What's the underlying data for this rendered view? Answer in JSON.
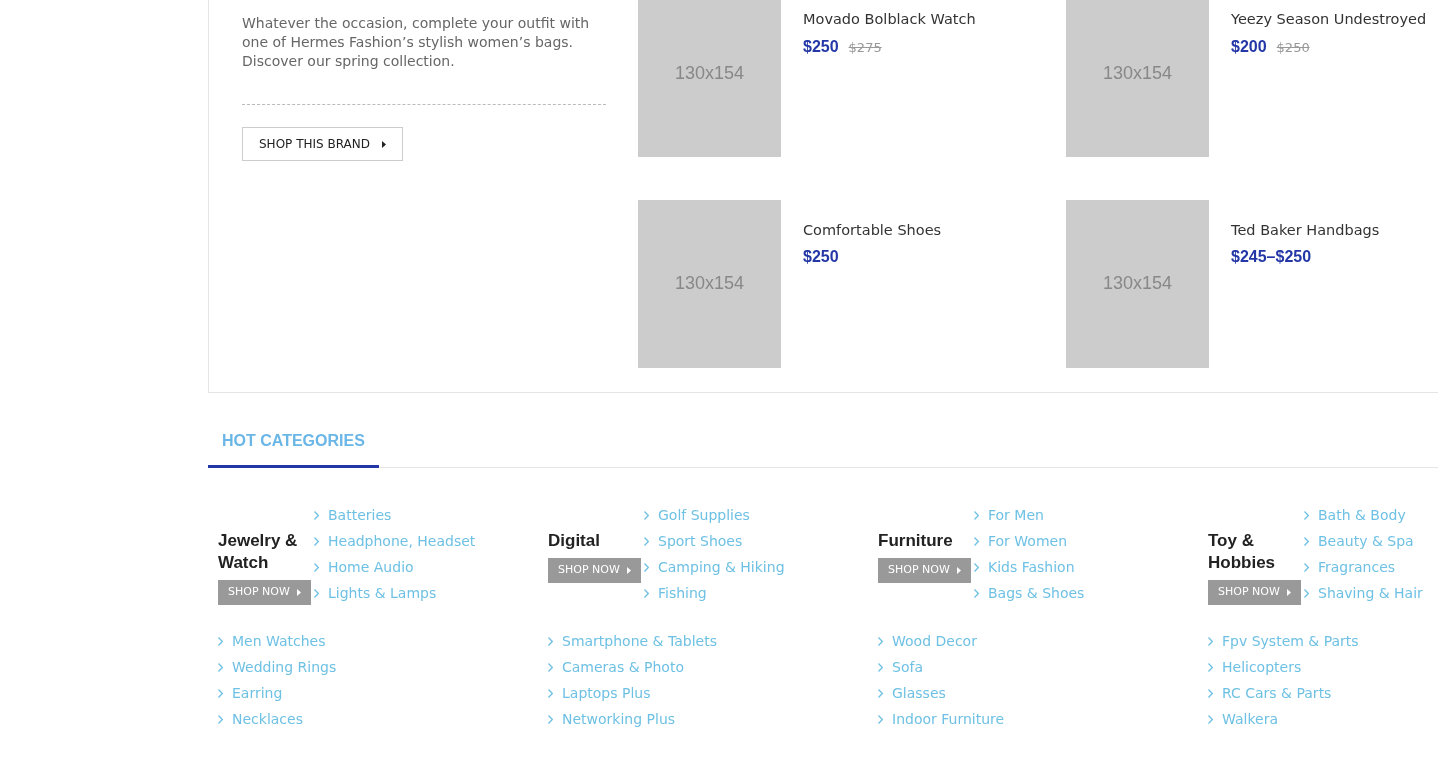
{
  "brand": {
    "description": "Whatever the occasion, complete your outfit with one of Hermes Fashion’s stylish women’s bags. Discover our spring collection.",
    "button": "SHOP THIS BRAND"
  },
  "products": [
    {
      "image": "130x154",
      "name": "Movado Bolblack Watch",
      "price": "$250",
      "old_price": "$275"
    },
    {
      "image": "130x154",
      "name": "Yeezy Season Undestroyed",
      "price": "$200",
      "old_price": "$250"
    },
    {
      "image": "130x154",
      "name": "Comfortable Shoes",
      "price": "$250"
    },
    {
      "image": "130x154",
      "name": "Ted Baker Handbags",
      "price": "$245–$250"
    }
  ],
  "tabs": [
    {
      "label": "HOT CATEGORIES",
      "selected": true
    }
  ],
  "categories": [
    {
      "title": "Jewelry & Watch",
      "button": "SHOP NOW",
      "links": [
        "Batteries",
        "Headphone, Headset",
        "Home Audio",
        "Lights & Lamps"
      ],
      "more_links": [
        "Men Watches",
        "Wedding Rings",
        "Earring",
        "Necklaces"
      ]
    },
    {
      "title": "Digital",
      "button": "SHOP NOW",
      "links": [
        "Golf Supplies",
        "Sport Shoes",
        "Camping & Hiking",
        "Fishing"
      ],
      "more_links": [
        "Smartphone & Tablets",
        "Cameras & Photo",
        "Laptops Plus",
        "Networking Plus"
      ]
    },
    {
      "title": "Furniture",
      "button": "SHOP NOW",
      "links": [
        "For Men",
        "For Women",
        "Kids Fashion",
        "Bags & Shoes"
      ],
      "more_links": [
        "Wood Decor",
        "Sofa",
        "Glasses",
        "Indoor Furniture"
      ]
    },
    {
      "title": "Toy & Hobbies",
      "button": "SHOP NOW",
      "links": [
        "Bath & Body",
        "Beauty & Spa",
        "Fragrances",
        "Shaving & Hair"
      ],
      "more_links": [
        "Fpv System & Parts",
        "Helicopters",
        "RC Cars & Parts",
        "Walkera"
      ]
    }
  ]
}
